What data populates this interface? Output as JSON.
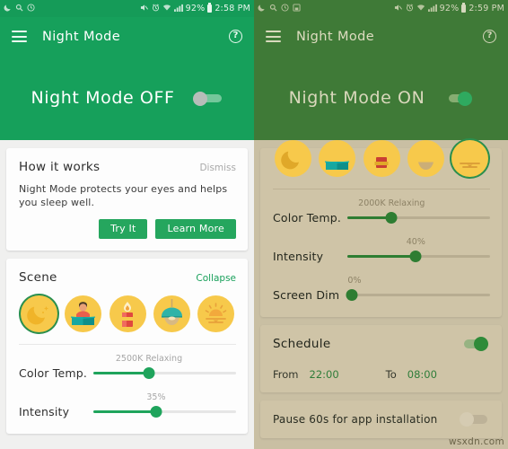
{
  "screens": [
    {
      "id": "left",
      "statusbar": {
        "left_icons": [
          "moon-icon",
          "search-icon",
          "call-icon"
        ],
        "right_icons": [
          "mute-icon",
          "alarm-icon",
          "wifi-icon",
          "signal-icon"
        ],
        "battery_percent": "92%",
        "time": "2:58 PM"
      },
      "appbar": {
        "title": "Night Mode",
        "menu_icon": "hamburger-icon",
        "help_icon": "help-icon"
      },
      "hero": {
        "label": "Night Mode OFF",
        "toggle_state": "off"
      },
      "how_it_works": {
        "title": "How it works",
        "dismiss": "Dismiss",
        "body": "Night Mode protects your eyes and helps you sleep well.",
        "try_it": "Try It",
        "learn_more": "Learn More"
      },
      "scene": {
        "title": "Scene",
        "action": "Collapse",
        "items": [
          {
            "name": "moon-scene-icon",
            "selected": true
          },
          {
            "name": "reading-scene-icon",
            "selected": false
          },
          {
            "name": "candle-scene-icon",
            "selected": false
          },
          {
            "name": "lamp-scene-icon",
            "selected": false
          },
          {
            "name": "sunset-scene-icon",
            "selected": false
          }
        ]
      },
      "sliders": [
        {
          "label": "Color Temp.",
          "value_label": "2500K Relaxing",
          "percent": 39
        },
        {
          "label": "Intensity",
          "value_label": "35%",
          "percent": 44
        }
      ]
    },
    {
      "id": "right",
      "statusbar": {
        "left_icons": [
          "moon-icon",
          "search-icon",
          "call-icon",
          "sdcard-icon"
        ],
        "right_icons": [
          "mute-icon",
          "alarm-icon",
          "wifi-icon",
          "signal-icon"
        ],
        "battery_percent": "92%",
        "time": "2:59 PM"
      },
      "appbar": {
        "title": "Night Mode",
        "menu_icon": "hamburger-icon",
        "help_icon": "help-icon"
      },
      "hero": {
        "label": "Night Mode  ON",
        "toggle_state": "on"
      },
      "scene": {
        "items": [
          {
            "name": "moon-scene-icon",
            "selected": false
          },
          {
            "name": "reading-scene-icon",
            "selected": false
          },
          {
            "name": "candle-scene-icon",
            "selected": false
          },
          {
            "name": "lamp-scene-icon",
            "selected": false
          },
          {
            "name": "sunset-scene-icon",
            "selected": true
          }
        ]
      },
      "sliders": [
        {
          "label": "Color Temp.",
          "value_label": "2000K Relaxing",
          "percent": 31
        },
        {
          "label": "Intensity",
          "value_label": "40%",
          "percent": 48
        },
        {
          "label": "Screen Dim",
          "value_label": "0%",
          "percent": 3
        }
      ],
      "schedule": {
        "title": "Schedule",
        "toggle_state": "on",
        "from_label": "From",
        "from_value": "22:00",
        "to_label": "To",
        "to_value": "08:00"
      },
      "pause": {
        "label": "Pause 60s for app installation",
        "toggle_state": "off"
      },
      "watermark": "wsxdn.com"
    }
  ],
  "colors": {
    "green_primary": "#16a05b",
    "green_muted": "#3f7a37",
    "scene_yellow": "#f7c94b",
    "slider_green": "#1fa45c",
    "sepia_bg": "#c9bfa3"
  }
}
